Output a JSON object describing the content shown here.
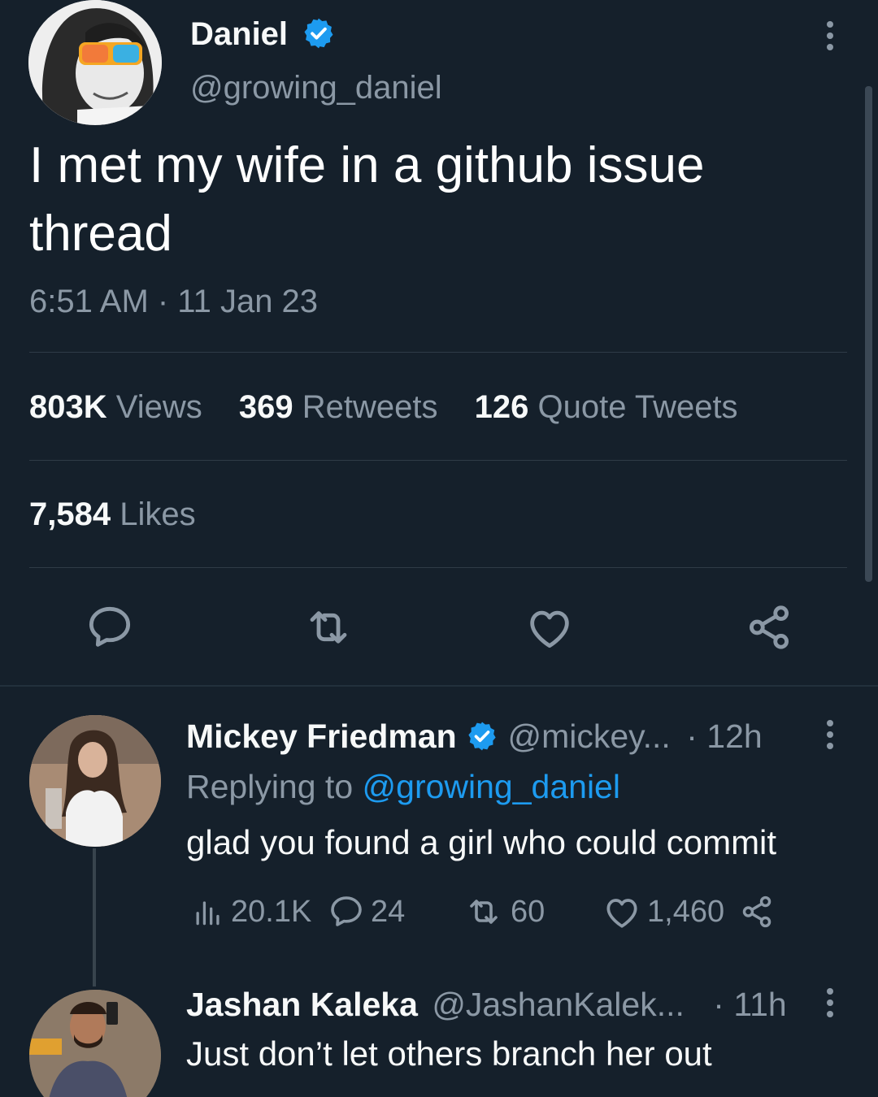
{
  "tweet": {
    "author_name": "Daniel",
    "author_handle": "@growing_daniel",
    "text": "I met my wife in a github issue thread",
    "timestamp": "6:51 AM · 11 Jan 23",
    "views_count": "803K",
    "views_label": "Views",
    "retweets_count": "369",
    "retweets_label": "Retweets",
    "quotes_count": "126",
    "quotes_label": "Quote Tweets",
    "likes_count": "7,584",
    "likes_label": "Likes",
    "actions": [
      "reply-icon",
      "retweet-icon",
      "like-icon",
      "share-icon"
    ]
  },
  "replies": [
    {
      "name": "Mickey Friedman",
      "handle": "@mickey...",
      "time": "· 12h",
      "replying_prefix": "Replying to",
      "replying_to": "@growing_daniel",
      "text": "glad you found a girl who could commit",
      "views": "20.1K",
      "comments": "24",
      "retweets": "60",
      "likes": "1,460"
    },
    {
      "name": "Jashan Kaleka",
      "handle": "@JashanKalek...",
      "time": "· 11h",
      "text": "Just don’t let others branch her out"
    }
  ],
  "colors": {
    "background": "#15202b",
    "accent": "#1d9bf0",
    "muted": "#8b98a5",
    "verified": "#1d9bf0"
  }
}
